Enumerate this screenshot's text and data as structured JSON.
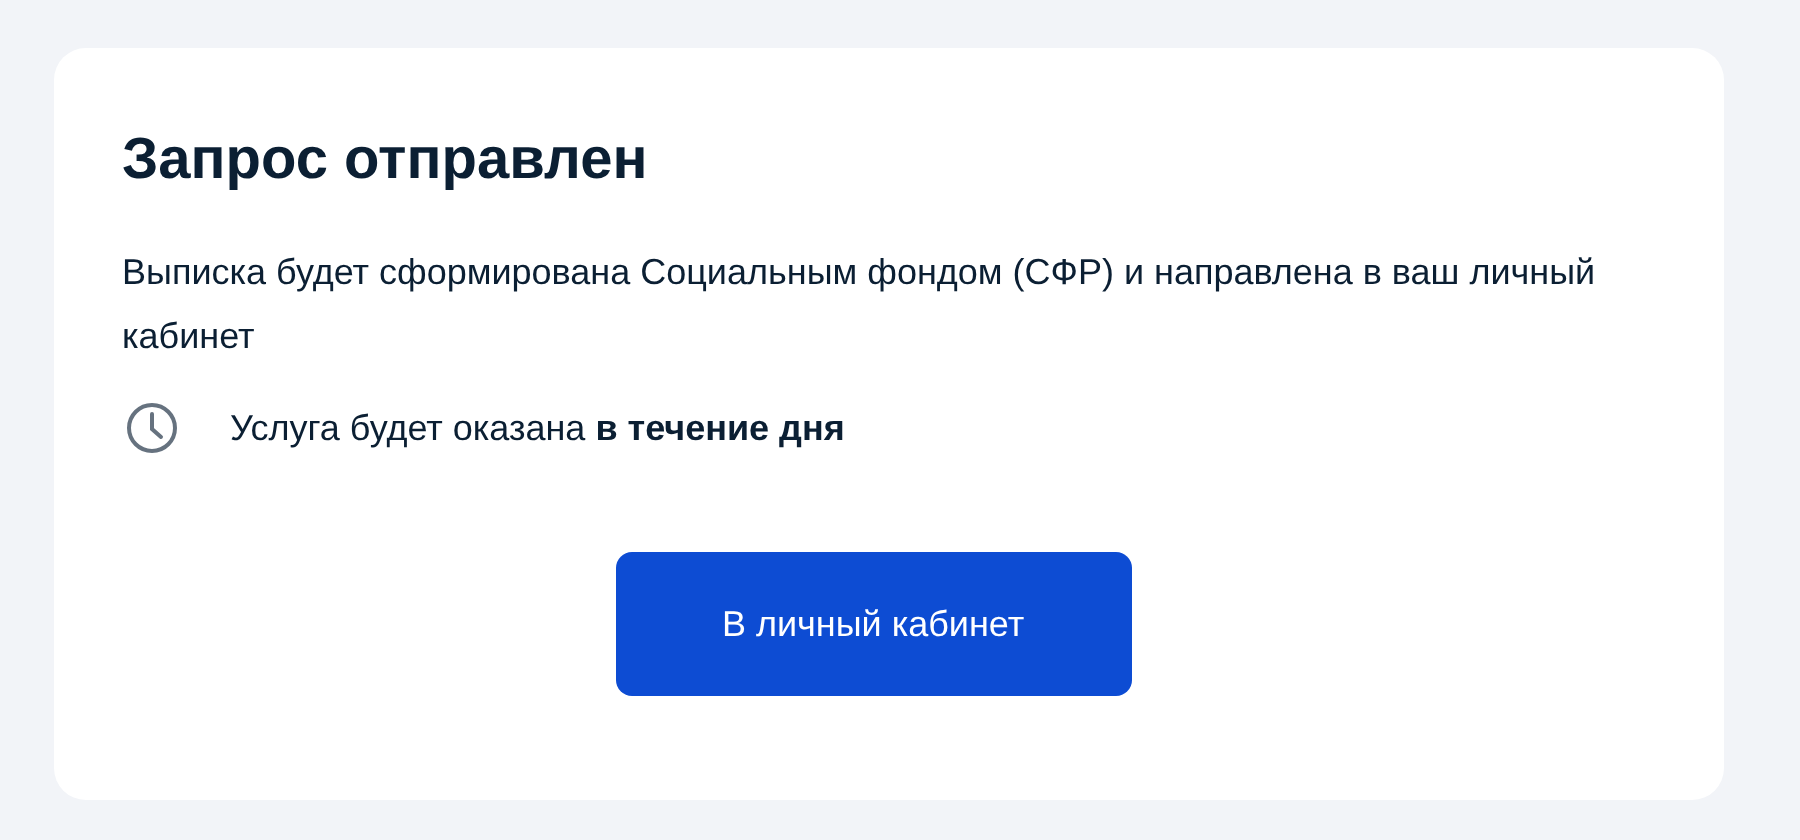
{
  "title": "Запрос отправлен",
  "description": "Выписка будет сформирована Социальным фондом (СФР) и направлена в ваш личный кабинет",
  "notice": "Услуга будет оказана **в течение дня**",
  "button": "В личный кабинет"
}
